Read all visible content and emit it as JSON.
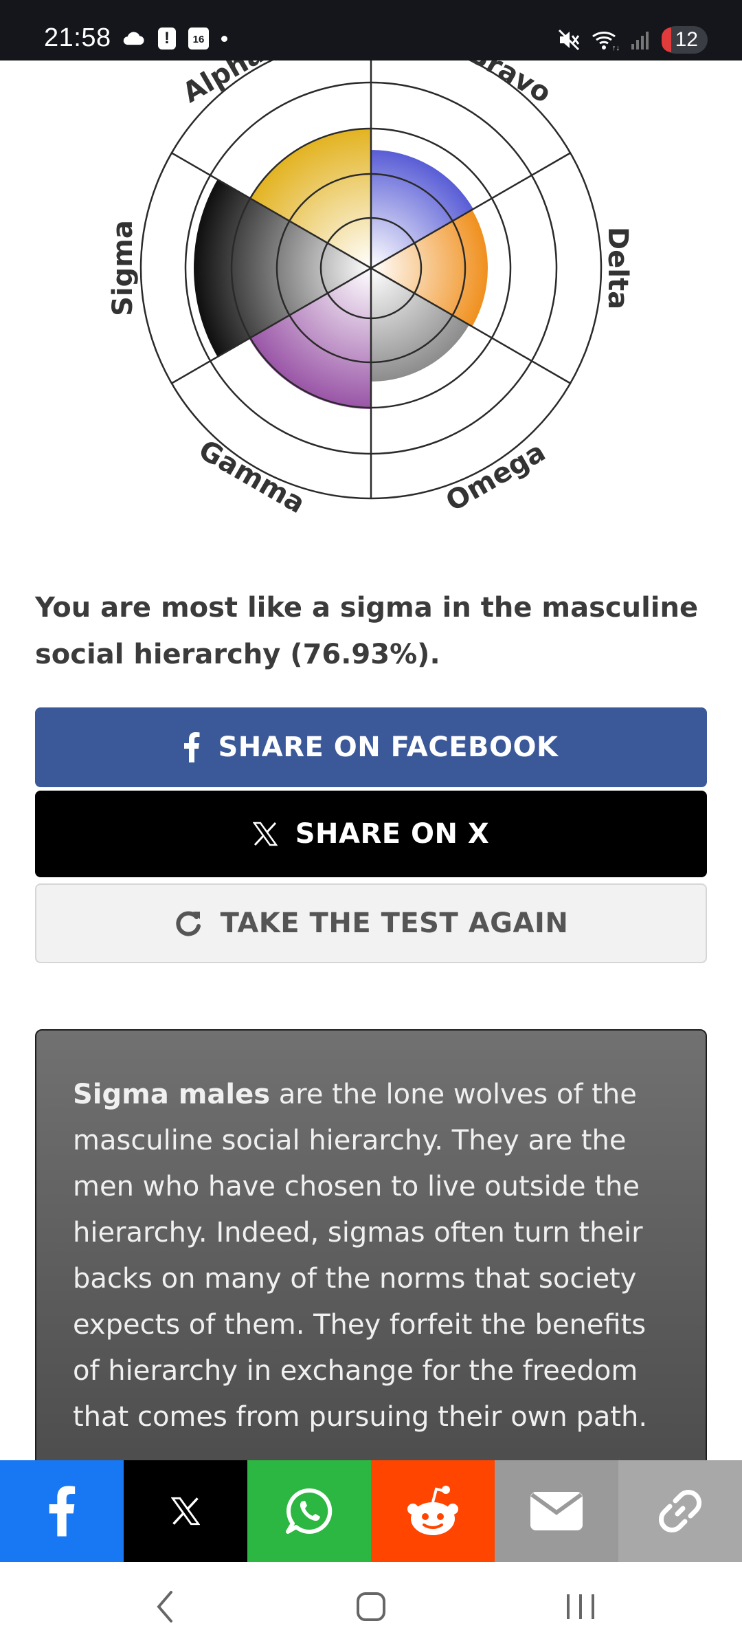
{
  "status_bar": {
    "time": "21:58",
    "calendar_day": "16",
    "notification_count": "12"
  },
  "chart": {
    "labels": {
      "alpha": "Alpha",
      "bravo": "Bravo",
      "delta": "Delta",
      "omega": "Omega",
      "gamma": "Gamma",
      "sigma": "Sigma"
    },
    "colors": {
      "alpha": "#e3b424",
      "bravo": "#5b5fd6",
      "delta": "#f0901e",
      "omega": "#8c8c8c",
      "gamma": "#9b58a8",
      "sigma": "#111111"
    }
  },
  "result": {
    "text": "You are most like a sigma in the masculine social hierarchy (76.93%)."
  },
  "buttons": {
    "facebook": "SHARE ON FACEBOOK",
    "x": "SHARE ON X",
    "again": "TAKE THE TEST AGAIN"
  },
  "description": {
    "bold": "Sigma males",
    "rest": " are the lone wolves of the masculine social hierarchy. They are the men who have chosen to live outside the hierarchy. Indeed, sigmas often turn their backs on many of the norms that society expects of them. They forfeit the benefits of hierarchy in exchange for the freedom that comes from pursuing their own path."
  },
  "share_bar": {
    "icons": [
      "facebook-icon",
      "x-icon",
      "whatsapp-icon",
      "reddit-icon",
      "email-icon",
      "link-icon"
    ]
  },
  "navigation": {
    "icons": [
      "back-icon",
      "home-icon",
      "recent-apps-icon"
    ]
  }
}
